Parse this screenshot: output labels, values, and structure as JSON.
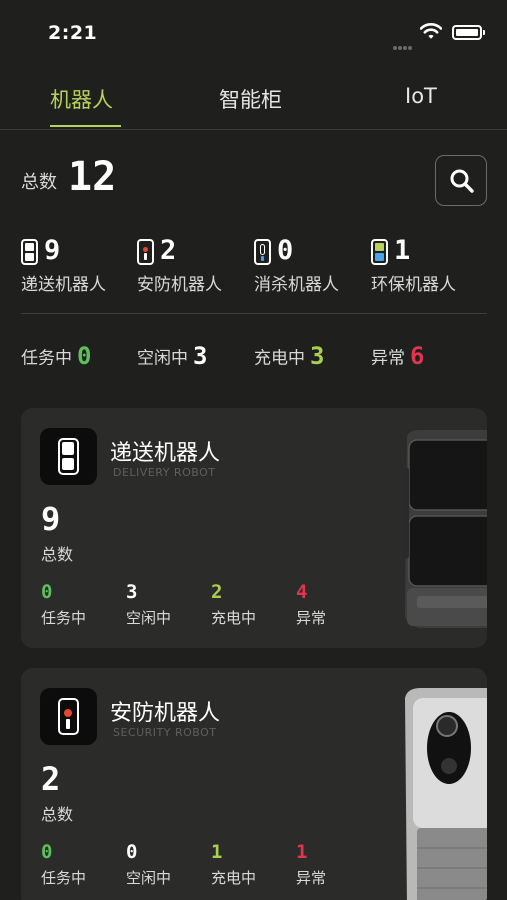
{
  "status_bar": {
    "time": "2:21"
  },
  "tabs": [
    {
      "label": "机器人"
    },
    {
      "label": "智能柜"
    },
    {
      "label": "IoT"
    }
  ],
  "summary": {
    "total_label": "总数",
    "total_value": "12"
  },
  "types": [
    {
      "value": "9",
      "label": "递送机器人"
    },
    {
      "value": "2",
      "label": "安防机器人"
    },
    {
      "value": "0",
      "label": "消杀机器人"
    },
    {
      "value": "1",
      "label": "环保机器人"
    }
  ],
  "statuses": [
    {
      "label": "任务中",
      "value": "0",
      "color": "#5cc05c"
    },
    {
      "label": "空闲中",
      "value": "3",
      "color": "#ffffff"
    },
    {
      "label": "充电中",
      "value": "3",
      "color": "#a8d04e"
    },
    {
      "label": "异常",
      "value": "6",
      "color": "#e1344d"
    }
  ],
  "cards": [
    {
      "title": "递送机器人",
      "subtitle": "DELIVERY ROBOT",
      "total": "9",
      "total_label": "总数",
      "stats": [
        {
          "value": "0",
          "label": "任务中"
        },
        {
          "value": "3",
          "label": "空闲中"
        },
        {
          "value": "2",
          "label": "充电中"
        },
        {
          "value": "4",
          "label": "异常"
        }
      ]
    },
    {
      "title": "安防机器人",
      "subtitle": "SECURITY ROBOT",
      "total": "2",
      "total_label": "总数",
      "stats": [
        {
          "value": "0",
          "label": "任务中"
        },
        {
          "value": "0",
          "label": "空闲中"
        },
        {
          "value": "1",
          "label": "充电中"
        },
        {
          "value": "1",
          "label": "异常"
        }
      ]
    }
  ]
}
